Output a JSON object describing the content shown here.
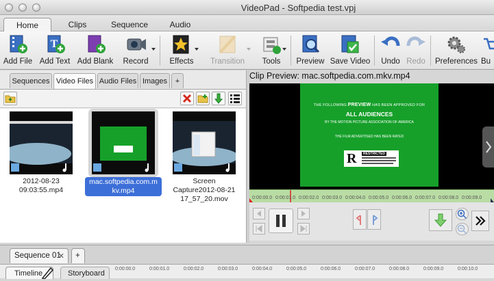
{
  "window": {
    "title": "VideoPad - Softpedia test.vpj"
  },
  "ribbon_tabs": [
    "Home",
    "Clips",
    "Sequence",
    "Audio"
  ],
  "toolbar": {
    "add_file": "Add File",
    "add_text": "Add Text",
    "add_blank": "Add Blank",
    "record": "Record",
    "effects": "Effects",
    "transition": "Transition",
    "tools": "Tools",
    "preview": "Preview",
    "save_video": "Save Video",
    "undo": "Undo",
    "redo": "Redo",
    "preferences": "Preferences",
    "buy": "Bu"
  },
  "bin_tabs": [
    "Sequences",
    "Video Files",
    "Audio Files",
    "Images",
    "+"
  ],
  "files": [
    {
      "caption_line1": "2012-08-23",
      "caption_line2": "09:03:55.mp4",
      "selected": false
    },
    {
      "caption_line1": "mac.softpedia.com.m",
      "caption_line2": "kv.mp4",
      "selected": true
    },
    {
      "caption_line1": "Screen",
      "caption_line2": "Capture2012-08-21",
      "caption_line3": "17_57_20.mov",
      "selected": false
    }
  ],
  "preview": {
    "title": "Clip Preview: mac.softpedia.com.mkv.mp4",
    "rating_card": {
      "line1_a": "THE FOLLOWING",
      "line1_b": "PREVIEW",
      "line1_c": "HAS BEEN APPROVED FOR",
      "line2": "ALL AUDIENCES",
      "line3": "BY THE MOTION PICTURE ASSOCIATION OF AMERICA",
      "line4": "THE FILM ADVERTISED HAS BEEN RATED",
      "rating": "R",
      "restricted": "RESTRICTED"
    },
    "ruler_ticks": [
      "0:00:00.0",
      "0:00:01.0",
      "0:00:02.0",
      "0:00:03.0",
      "0:00:04.0",
      "0:00:05.0",
      "0:00:06.0",
      "0:00:07.0",
      "0:00:08.0",
      "0:00:09.0"
    ]
  },
  "sequence_tabs": [
    "Sequence 01",
    "+"
  ],
  "bottom": {
    "timeline": "Timeline",
    "storyboard": "Storyboard",
    "ruler_ticks": [
      "0:00:00.0",
      "0:00:01.0",
      "0:00:02.0",
      "0:00:03.0",
      "0:00:04.0",
      "0:00:05.0",
      "0:00:06.0",
      "0:00:07.0",
      "0:00:08.0",
      "0:00:09.0",
      "0:00:10.0"
    ]
  }
}
